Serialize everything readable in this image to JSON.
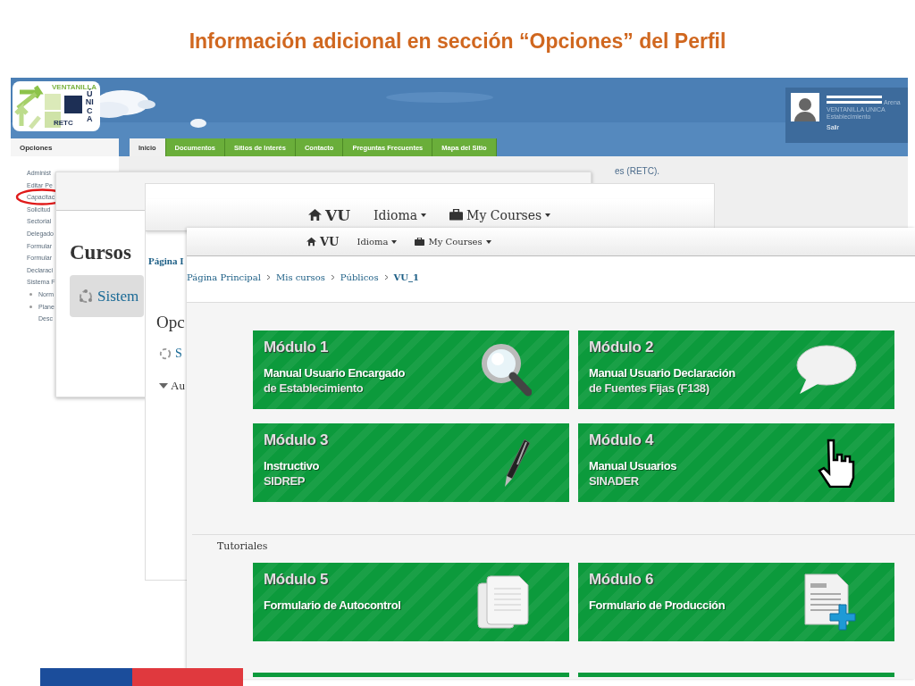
{
  "slide_title": "Información adicional en sección “Opciones” del Perfil",
  "portal": {
    "logo": {
      "top": "VENTANILLA",
      "side": "ÚNICA",
      "bottom": "RETC"
    },
    "user": {
      "cut": "Arena",
      "org": "VENTANILLA UNICA",
      "role": "Establecimiento",
      "logout": "Salir"
    },
    "sidebar_title": "Opciones",
    "tabs": [
      {
        "label": "Inicio",
        "selected": true
      },
      {
        "label": "Documentos",
        "selected": false
      },
      {
        "label": "Sitios de Interés",
        "selected": false
      },
      {
        "label": "Contacto",
        "selected": false
      },
      {
        "label": "Preguntas Frecuentes",
        "selected": false
      },
      {
        "label": "Mapa del Sitio",
        "selected": false
      }
    ],
    "sidebar_items": [
      {
        "lines": [
          "Administ"
        ],
        "circled": false
      },
      {
        "lines": [
          "Editar Pe"
        ],
        "circled": false
      },
      {
        "lines": [
          "Capacitac"
        ],
        "circled": true
      },
      {
        "lines": [
          "Solicitud",
          "Sectorial"
        ],
        "circled": false
      },
      {
        "lines": [
          "Delegado"
        ],
        "circled": false
      },
      {
        "lines": [
          "Formular"
        ],
        "circled": false
      },
      {
        "lines": [
          "Formular"
        ],
        "circled": false
      },
      {
        "lines": [
          "Declaraci"
        ],
        "circled": false
      },
      {
        "lines": [
          "Sistema F"
        ],
        "circled": false
      }
    ],
    "sidebar_subitems": [
      {
        "lines": [
          "Norm"
        ]
      },
      {
        "lines": [
          "Plane",
          "Desc"
        ]
      }
    ],
    "intro_fragment": "es (RETC)."
  },
  "courses_window": {
    "heading": "Cursos",
    "card": "Sistem"
  },
  "course_window": {
    "nav": {
      "brand": "VU",
      "menus": [
        "Idioma",
        "My Courses"
      ]
    },
    "breadcrumb_fragment": "Página I",
    "heading": "Opc",
    "card": "S",
    "section": "Au"
  },
  "course_page": {
    "nav": {
      "brand": "VU",
      "menus": [
        "Idioma",
        "My Courses"
      ]
    },
    "breadcrumb": [
      {
        "label": "Página Principal",
        "current": false
      },
      {
        "label": "Mis cursos",
        "current": false
      },
      {
        "label": "Públicos",
        "current": false
      },
      {
        "label": "VU_1",
        "current": true
      }
    ],
    "modules": [
      {
        "title": "Módulo 1",
        "lines": [
          "Manual Usuario Encargado",
          "de Establecimiento"
        ],
        "kind": "magnifier"
      },
      {
        "title": "Módulo 2",
        "lines": [
          "Manual Usuario Declaración",
          "de Fuentes Fijas (F138)"
        ],
        "kind": "bubble"
      },
      {
        "title": "Módulo 3",
        "lines": [
          "Instructivo",
          "SIDREP"
        ],
        "kind": "pen"
      },
      {
        "title": "Módulo 4",
        "lines": [
          "Manual Usuarios",
          "SINADER"
        ],
        "kind": "hand"
      }
    ],
    "section": "Tutoriales",
    "tutorials": [
      {
        "title": "Módulo 5",
        "lines": [
          "Formulario de Autocontrol"
        ],
        "kind": "documents"
      },
      {
        "title": "Módulo 6",
        "lines": [
          "Formulario de Producción"
        ],
        "kind": "document-plus"
      }
    ]
  }
}
